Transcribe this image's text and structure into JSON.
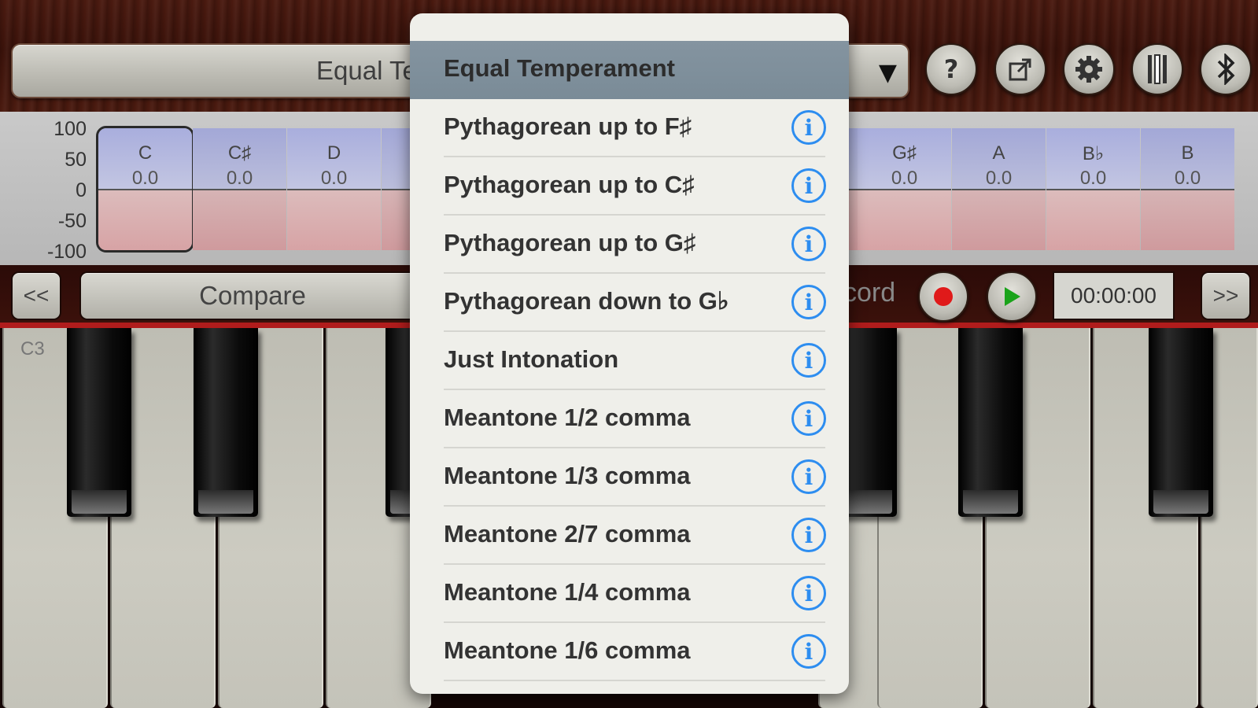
{
  "header": {
    "temperament_value": "Equal Temperament",
    "caret": "▼",
    "buttons": {
      "help": "?",
      "share": "⇱",
      "settings": "⚙",
      "sounds": "🍴",
      "bluetooth": "ᛒ"
    }
  },
  "tuning": {
    "axis": [
      "100",
      "50",
      "0",
      "-50",
      "-100"
    ],
    "notes": [
      {
        "name": "C",
        "value": "0.0"
      },
      {
        "name": "C♯",
        "value": "0.0"
      },
      {
        "name": "D",
        "value": "0.0"
      },
      {
        "name": "G♯",
        "value": "0.0"
      },
      {
        "name": "A",
        "value": "0.0"
      },
      {
        "name": "B♭",
        "value": "0.0"
      },
      {
        "name": "B",
        "value": "0.0"
      }
    ]
  },
  "transport": {
    "prev": "<<",
    "compare": "Compare",
    "record_partial": "cord",
    "timer": "00:00:00",
    "next": ">>",
    "record_color": "#e01a1a",
    "play_color": "#1aa31a"
  },
  "keyboard": {
    "octave_label": "C3"
  },
  "dropdown": {
    "selected": "Equal Temperament",
    "options": [
      "Pythagorean up to F♯",
      "Pythagorean up to C♯",
      "Pythagorean up to G♯",
      "Pythagorean down to G♭",
      "Just Intonation",
      "Meantone 1/2 comma",
      "Meantone 1/3 comma",
      "Meantone 2/7 comma",
      "Meantone 1/4 comma",
      "Meantone 1/6 comma"
    ],
    "info_icon": "i"
  }
}
